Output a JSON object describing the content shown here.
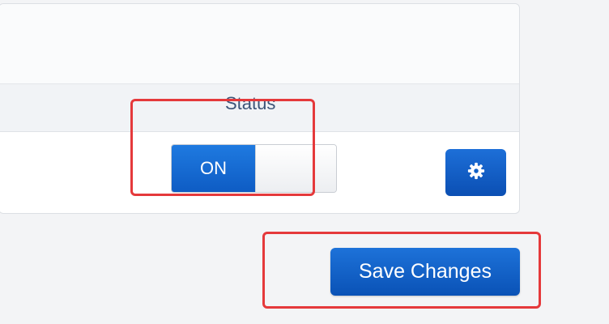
{
  "table": {
    "columns": {
      "status": "Status"
    }
  },
  "row": {
    "status_toggle": {
      "on_label": "ON",
      "state": "on"
    }
  },
  "actions": {
    "save_label": "Save Changes"
  },
  "icons": {
    "settings": "gear-icon"
  },
  "colors": {
    "accent": "#0e5cc4",
    "highlight": "#e5393b"
  }
}
